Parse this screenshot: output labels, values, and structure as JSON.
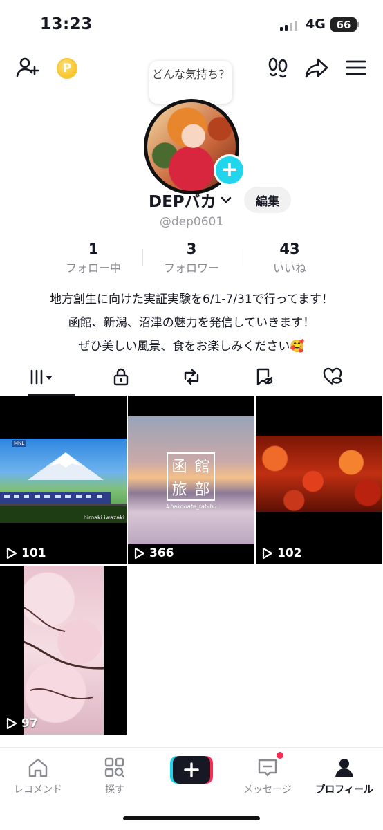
{
  "status_bar": {
    "time": "13:23",
    "network": "4G",
    "battery": "66"
  },
  "header": {
    "icons": [
      "add-friend-icon",
      "coin-icon",
      "footprints-icon",
      "share-icon",
      "menu-icon"
    ],
    "mood_bubble": "どんな気持ち？"
  },
  "profile": {
    "display_name": "DEPバカ",
    "edit_label": "編集",
    "handle": "@dep0601",
    "stats": [
      {
        "value": "1",
        "label": "フォロー中"
      },
      {
        "value": "3",
        "label": "フォロワー"
      },
      {
        "value": "43",
        "label": "いいね"
      }
    ],
    "bio_lines": [
      "地方創生に向けた実証実験を6/1-7/31で行ってます！",
      "函館、新潟、沼津の魅力を発信していきます！",
      "ぜひ美しい風景、食をお楽しみください🥰"
    ]
  },
  "tabs": [
    "videos-tab-icon",
    "private-tab-icon",
    "repost-tab-icon",
    "favorites-tab-icon",
    "liked-tab-icon"
  ],
  "videos": [
    {
      "views": "101",
      "overlay_text": "hiroaki.iwazaki",
      "badge": "MNL"
    },
    {
      "views": "366",
      "title_chars": [
        "函",
        "館",
        "旅",
        "部"
      ],
      "tag": "#hakodate_tabibu"
    },
    {
      "views": "102"
    },
    {
      "views": "97"
    }
  ],
  "bottom_nav": [
    {
      "label": "レコメンド",
      "icon": "home-icon"
    },
    {
      "label": "探す",
      "icon": "explore-icon"
    },
    {
      "label": "",
      "icon": "create-icon"
    },
    {
      "label": "メッセージ",
      "icon": "inbox-icon"
    },
    {
      "label": "プロフィール",
      "icon": "profile-icon"
    }
  ],
  "colors": {
    "accent": "#20d5ec",
    "notification": "#fe2c55",
    "text": "#161823"
  }
}
